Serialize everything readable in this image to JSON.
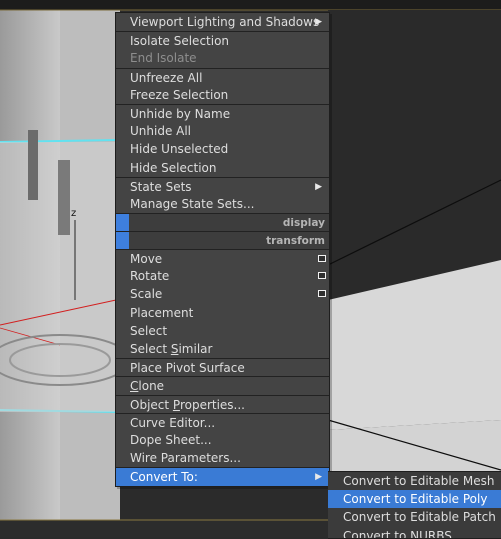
{
  "quad_menu": {
    "items": [
      {
        "label": "Viewport Lighting and Shadows",
        "has_submenu": true
      },
      {
        "label": "Isolate Selection"
      },
      {
        "label": "End Isolate",
        "disabled": true
      },
      {
        "label": "Unfreeze All"
      },
      {
        "label": "Freeze Selection"
      },
      {
        "label": "Unhide by Name"
      },
      {
        "label": "Unhide All"
      },
      {
        "label": "Hide Unselected"
      },
      {
        "label": "Hide Selection"
      },
      {
        "label": "State Sets",
        "has_submenu": true
      },
      {
        "label": "Manage State Sets..."
      }
    ],
    "headers": {
      "display": "display",
      "transform": "transform"
    },
    "transform_items": [
      {
        "label": "Move",
        "has_options": true
      },
      {
        "label": "Rotate",
        "has_options": true
      },
      {
        "label": "Scale",
        "has_options": true
      },
      {
        "label": "Placement"
      },
      {
        "label": "Select"
      },
      {
        "label_pre": "Select ",
        "label_ul": "S",
        "label_post": "imilar"
      },
      {
        "label": "Place Pivot Surface"
      },
      {
        "label_pre": "",
        "label_ul": "C",
        "label_post": "lone"
      },
      {
        "label_pre": "Object ",
        "label_ul": "P",
        "label_post": "roperties..."
      },
      {
        "label": "Curve Editor..."
      },
      {
        "label": "Dope Sheet..."
      },
      {
        "label": "Wire Parameters..."
      },
      {
        "label": "Convert To:",
        "has_submenu": true,
        "active": true
      }
    ]
  },
  "submenu": {
    "items": [
      {
        "label": "Convert to Editable Mesh"
      },
      {
        "label": "Convert to Editable Poly",
        "active": true
      },
      {
        "label": "Convert to Editable Patch"
      },
      {
        "label": "Convert to NURBS"
      }
    ]
  },
  "viewport": {
    "axis_label": "z"
  },
  "colors": {
    "menu_bg": "#444444",
    "highlight": "#3a7bd5",
    "header_swatch": "#3e7fde",
    "viewport_bg": "#2b2b2b"
  }
}
